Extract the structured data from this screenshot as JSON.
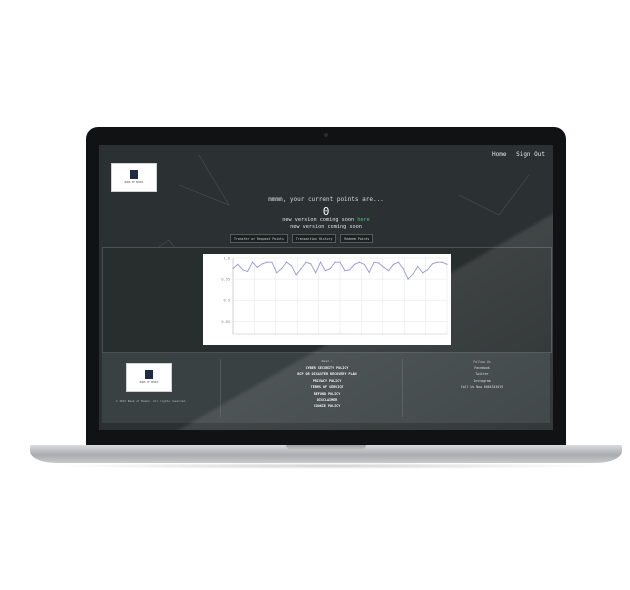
{
  "nav": {
    "home": "Home",
    "signout": "Sign Out"
  },
  "logo": {
    "text": "BANK OF BOOKS"
  },
  "points": {
    "label": "mmmm, your current points are...",
    "value": "0",
    "version_prefix": "new version coming soon",
    "version_link": "here",
    "version_line2": "new version coming soon"
  },
  "buttons": {
    "transfer": "Transfer or Request Points",
    "history": "Transaction History",
    "redeem": "Redeem Points"
  },
  "chart_data": {
    "type": "line",
    "y_ticks": [
      "1.0",
      "0.95",
      "0.9",
      "0.85"
    ],
    "values": [
      0.975,
      0.985,
      0.972,
      0.968,
      0.99,
      0.978,
      0.986,
      0.99,
      0.99,
      0.965,
      0.975,
      0.99,
      0.982,
      0.96,
      0.975,
      0.99,
      0.986,
      0.965,
      0.99,
      0.97,
      0.975,
      0.99,
      0.99,
      0.97,
      0.972,
      0.985,
      0.99,
      0.985,
      0.966,
      0.99,
      0.988,
      0.978,
      0.97,
      0.985,
      0.99,
      0.975,
      0.95,
      0.962,
      0.98,
      0.965,
      0.972,
      0.986,
      0.99,
      0.99,
      0.985
    ],
    "ylim": [
      0.82,
      1.0
    ],
    "xlabel": "",
    "series_color": "#9b97d8",
    "grid": true
  },
  "footer": {
    "copyright": "© 2021 Bank of Books. All rights reserved.",
    "links_title": "Read :",
    "links": [
      "CYBER SECURITY POLICY",
      "BCP OR DISASTER RECOVERY PLAN",
      "PRIVACY POLICY",
      "TERMS OF SERVICE",
      "REFUND POLICY",
      "DISCLAIMER",
      "COOKIE POLICY"
    ],
    "follow_title": "Follow Us",
    "social": [
      "Facebook",
      "Twitter",
      "Instagram"
    ],
    "call": "Call Us Now 0064343019"
  },
  "colors": {
    "screen_bg": "#2b3132",
    "footer_bg": "#3a4143",
    "accent_green": "#4fbf7a"
  }
}
